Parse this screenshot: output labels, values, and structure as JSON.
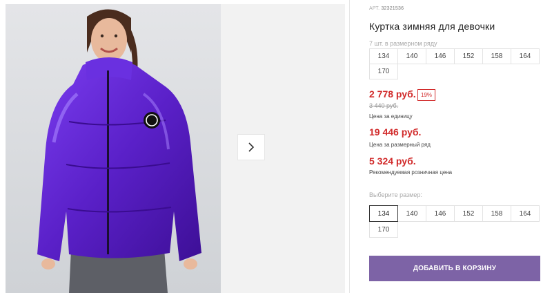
{
  "product": {
    "art_label": "АРТ.",
    "art_value": "32321536",
    "title": "Куртка зимняя для девочки",
    "image_alt": "Девочка в фиолетовой куртке"
  },
  "gallery": {
    "next_icon": "chevron-right-icon"
  },
  "pack": {
    "note": "7 шт. в размерном ряду",
    "sizes": [
      "134",
      "140",
      "146",
      "152",
      "158",
      "164",
      "170"
    ]
  },
  "prices": {
    "current": "2 778 руб.",
    "discount": "19%",
    "old": "3 440 руб.",
    "unit_note": "Цена за единицу",
    "set_price": "19 446 руб.",
    "set_note": "Цена за размерный ряд",
    "rrp": "5 324 руб.",
    "rrp_note": "Рекомендуемая розничная цена"
  },
  "size_select": {
    "label": "Выберите размер:",
    "options": [
      "134",
      "140",
      "146",
      "152",
      "158",
      "164",
      "170"
    ],
    "selected": "134"
  },
  "cart": {
    "button_label": "ДОБАВИТЬ В КОРЗИНУ"
  },
  "colors": {
    "accent": "#7d63a6",
    "price_red": "#d12a2a",
    "jacket": "#5a20c8"
  }
}
